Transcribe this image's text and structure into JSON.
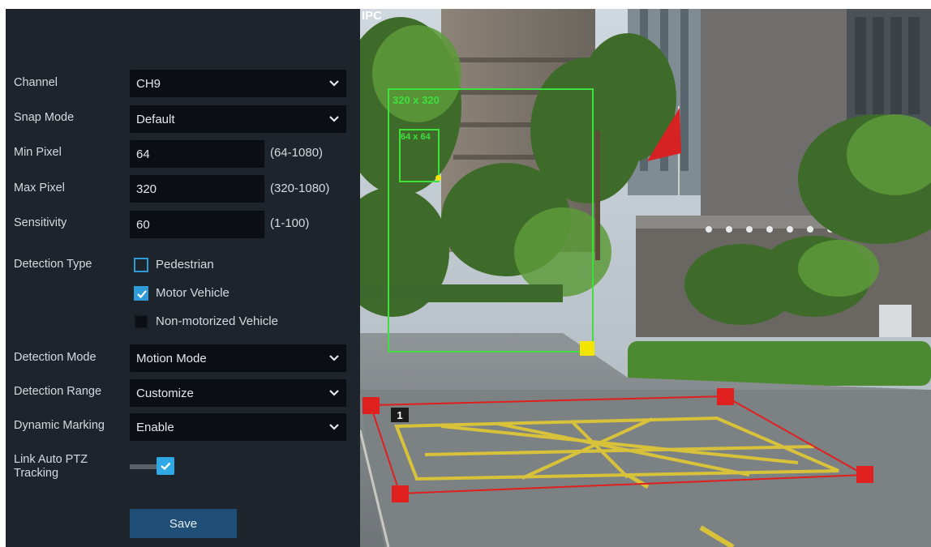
{
  "panel": {
    "channel": {
      "label": "Channel",
      "value": "CH9"
    },
    "snap_mode": {
      "label": "Snap Mode",
      "value": "Default"
    },
    "min_pixel": {
      "label": "Min Pixel",
      "value": "64",
      "range": "(64-1080)"
    },
    "max_pixel": {
      "label": "Max Pixel",
      "value": "320",
      "range": "(320-1080)"
    },
    "sensitivity": {
      "label": "Sensitivity",
      "value": "60",
      "range": "(1-100)"
    },
    "detection_type": {
      "label": "Detection Type",
      "options": [
        {
          "label": "Pedestrian",
          "checked": false
        },
        {
          "label": "Motor Vehicle",
          "checked": true
        },
        {
          "label": "Non-motorized Vehicle",
          "checked": false
        }
      ]
    },
    "detection_mode": {
      "label": "Detection Mode",
      "value": "Motion Mode"
    },
    "detection_range": {
      "label": "Detection Range",
      "value": "Customize"
    },
    "dynamic_marking": {
      "label": "Dynamic Marking",
      "value": "Enable"
    },
    "link_auto_ptz": {
      "label_line1": "Link Auto PTZ",
      "label_line2": "Tracking",
      "enabled": true
    },
    "save_label": "Save"
  },
  "video": {
    "channel_badge": "IPC",
    "max_box_label": "320 x 320",
    "min_box_label": "64 x 64",
    "zone_number": "1",
    "colors": {
      "max_box": "#3ee03e",
      "zone": "#e01f1f",
      "handle_yellow": "#f2e500"
    }
  }
}
